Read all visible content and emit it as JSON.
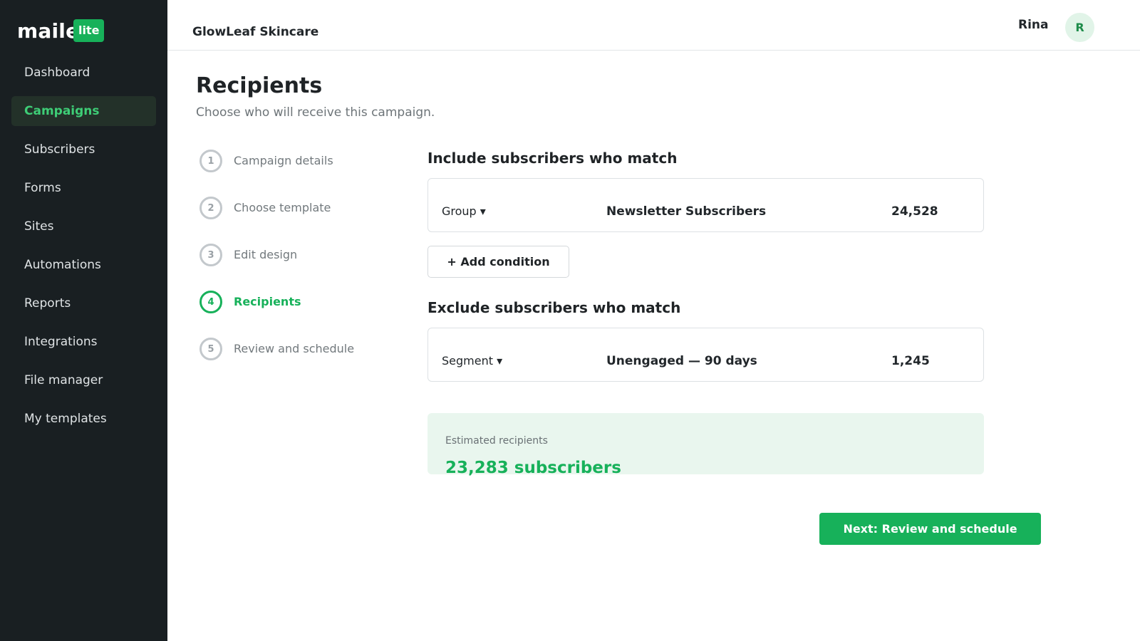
{
  "logo": {
    "text": "maile",
    "badge": "lite"
  },
  "sidebar": {
    "items": [
      {
        "label": "Dashboard",
        "active": false
      },
      {
        "label": "Campaigns",
        "active": true
      },
      {
        "label": "Subscribers",
        "active": false
      },
      {
        "label": "Forms",
        "active": false
      },
      {
        "label": "Sites",
        "active": false
      },
      {
        "label": "Automations",
        "active": false
      },
      {
        "label": "Reports",
        "active": false
      },
      {
        "label": "Integrations",
        "active": false
      },
      {
        "label": "File manager",
        "active": false
      },
      {
        "label": "My templates",
        "active": false
      }
    ]
  },
  "header": {
    "brand": "GlowLeaf Skincare",
    "user_name": "Rina",
    "avatar_initial": "R"
  },
  "page": {
    "title": "Recipients",
    "subtitle": "Choose who will receive this campaign."
  },
  "steps": [
    {
      "number": "1",
      "label": "Campaign details",
      "active": false
    },
    {
      "number": "2",
      "label": "Choose template",
      "active": false
    },
    {
      "number": "3",
      "label": "Edit design",
      "active": false
    },
    {
      "number": "4",
      "label": "Recipients",
      "active": true
    },
    {
      "number": "5",
      "label": "Review and schedule",
      "active": false
    }
  ],
  "include": {
    "title": "Include subscribers who match",
    "rule": {
      "field": "Group ▾",
      "value": "Newsletter Subscribers",
      "count": "24,528"
    },
    "add_condition_label": "+ Add condition"
  },
  "exclude": {
    "title": "Exclude subscribers who match",
    "rule": {
      "field": "Segment ▾",
      "value": "Unengaged — 90 days",
      "count": "1,245"
    }
  },
  "estimate": {
    "label": "Estimated recipients",
    "value": "23,283 subscribers"
  },
  "next_button": {
    "label": "Next: Review and schedule"
  },
  "colors": {
    "accent": "#17b15a",
    "sidebar_bg": "#191f22",
    "active_nav_bg": "#233129",
    "estimate_bg": "#e9f6ee"
  }
}
